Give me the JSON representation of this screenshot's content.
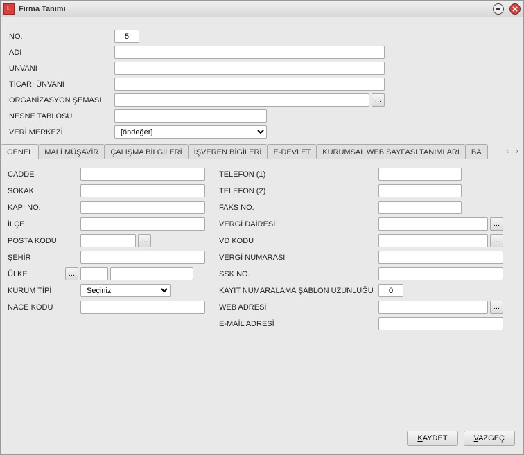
{
  "window": {
    "title": "Firma Tanımı"
  },
  "header": {
    "no_label": "NO.",
    "no_value": "5",
    "adi_label": "ADI",
    "unvani_label": "UNVANI",
    "ticari_unvani_label": "TİCARİ ÜNVANI",
    "org_semasi_label": "ORGANİZASYON ŞEMASI",
    "nesne_tablosu_label": "NESNE TABLOSU",
    "veri_merkezi_label": "VERİ MERKEZİ",
    "veri_merkezi_value": "[öndeğer]"
  },
  "tabs": [
    {
      "label": "GENEL",
      "active": true
    },
    {
      "label": "MALİ MÜŞAVİR"
    },
    {
      "label": "ÇALIŞMA BİLGİLERİ"
    },
    {
      "label": "İŞVEREN BİGİLERİ"
    },
    {
      "label": "E-DEVLET"
    },
    {
      "label": "KURUMSAL WEB SAYFASI TANIMLARI"
    },
    {
      "label": "BA"
    }
  ],
  "left": {
    "cadde": "CADDE",
    "sokak": "SOKAK",
    "kapi_no": "KAPI NO.",
    "ilce": "İLÇE",
    "posta_kodu": "POSTA KODU",
    "sehir": "ŞEHİR",
    "ulke": "ÜLKE",
    "kurum_tipi": "KURUM TİPİ",
    "kurum_tipi_value": "Seçiniz",
    "nace_kodu": "NACE KODU"
  },
  "right": {
    "telefon1": "TELEFON (1)",
    "telefon2": "TELEFON (2)",
    "faks_no": "FAKS NO.",
    "vergi_dairesi": "VERGİ DAİRESİ",
    "vd_kodu": "VD KODU",
    "vergi_numarasi": "VERGİ NUMARASI",
    "ssk_no": "SSK NO.",
    "kayit_sablon": "KAYIT NUMARALAMA ŞABLON UZUNLUĞU",
    "kayit_sablon_value": "0",
    "web_adresi": "WEB ADRESİ",
    "email_adresi": "E-MAİL ADRESİ"
  },
  "footer": {
    "kaydet_first": "K",
    "kaydet_rest": "AYDET",
    "vazgec_first": "V",
    "vazgec_rest": "AZGEÇ"
  }
}
